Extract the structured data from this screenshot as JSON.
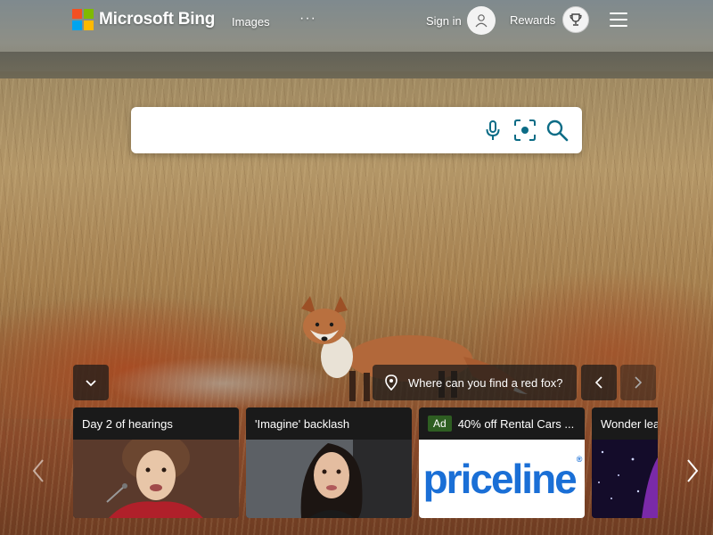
{
  "header": {
    "logo_text": "Microsoft Bing",
    "logo_colors": [
      "#f25022",
      "#7fba00",
      "#00a4ef",
      "#ffb900"
    ],
    "nav": {
      "images_label": "Images",
      "more_label": "···"
    },
    "signin_label": "Sign in",
    "rewards_label": "Rewards"
  },
  "search": {
    "value": "",
    "accent_color": "#0c6c86"
  },
  "hero": {
    "fact_label": "Where can you find a red fox?"
  },
  "carousel": {
    "cards": [
      {
        "title": "Day 2 of hearings",
        "ad": false
      },
      {
        "title": "'Imagine' backlash",
        "ad": false
      },
      {
        "title": "40% off Rental Cars ...",
        "ad": true,
        "ad_label": "Ad",
        "brand": "priceline",
        "brand_color": "#1a6fd6"
      },
      {
        "title": "Wonder lea",
        "ad": false
      }
    ]
  }
}
